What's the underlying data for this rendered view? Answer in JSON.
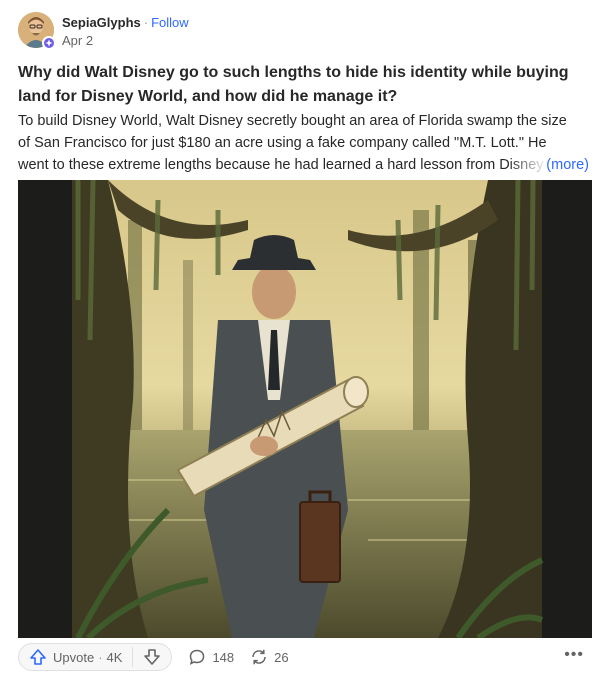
{
  "author": {
    "name": "SepiaGlyphs",
    "follow_label": "Follow",
    "separator": "·",
    "date": "Apr 2"
  },
  "question": {
    "title": "Why did Walt Disney go to such lengths to hide his identity while buying land for Disney World, and how did he manage it?"
  },
  "answer": {
    "lines": [
      "To build Disney World, Walt Disney secretly bought an area of Florida swamp the size",
      "of San Francisco for just $180 an acre using a fake company called \"M.T. Lott.\" He",
      "went to these extreme lengths because he had learned a hard lesson from Disney"
    ],
    "more_label": "(more)"
  },
  "image": {
    "icon": "swamp-illustration"
  },
  "actions": {
    "upvote_label": "Upvote",
    "upvote_count": "4K",
    "comments_count": "148",
    "shares_count": "26",
    "menu_label": "•••"
  },
  "colors": {
    "link": "#2e69ff",
    "text": "#282829",
    "muted": "#636466",
    "badge": "#6c5ce7"
  }
}
